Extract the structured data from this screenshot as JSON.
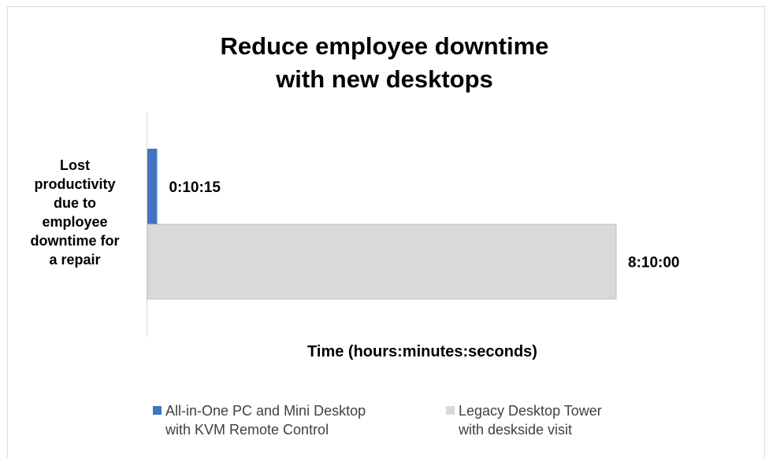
{
  "chart_data": {
    "type": "bar",
    "orientation": "horizontal",
    "title": "Reduce employee downtime with new desktops",
    "title_lines": [
      "Reduce employee downtime",
      "with new desktops"
    ],
    "categories": [
      "Lost productivity due to employee downtime for a repair"
    ],
    "category_label_lines": [
      "Lost",
      "productivity",
      "due to",
      "employee",
      "downtime for",
      "a repair"
    ],
    "xlabel": "Time (hours:minutes:seconds)",
    "ylabel": "",
    "x_unit": "seconds",
    "xlim": [
      0,
      29400
    ],
    "grid": false,
    "legend_position": "bottom",
    "series": [
      {
        "name": "All-in-One PC and Mini Desktop with KVM Remote Control",
        "name_lines": [
          "All-in-One PC and Mini Desktop",
          "with KVM Remote Control"
        ],
        "values": [
          615
        ],
        "data_labels": [
          "0:10:15"
        ],
        "color": "#4472c4"
      },
      {
        "name": "Legacy Desktop Tower with deskside visit",
        "name_lines": [
          "Legacy Desktop Tower",
          "with deskside visit"
        ],
        "values": [
          29400
        ],
        "data_labels": [
          "8:10:00"
        ],
        "color": "#d9d9d9"
      }
    ]
  }
}
